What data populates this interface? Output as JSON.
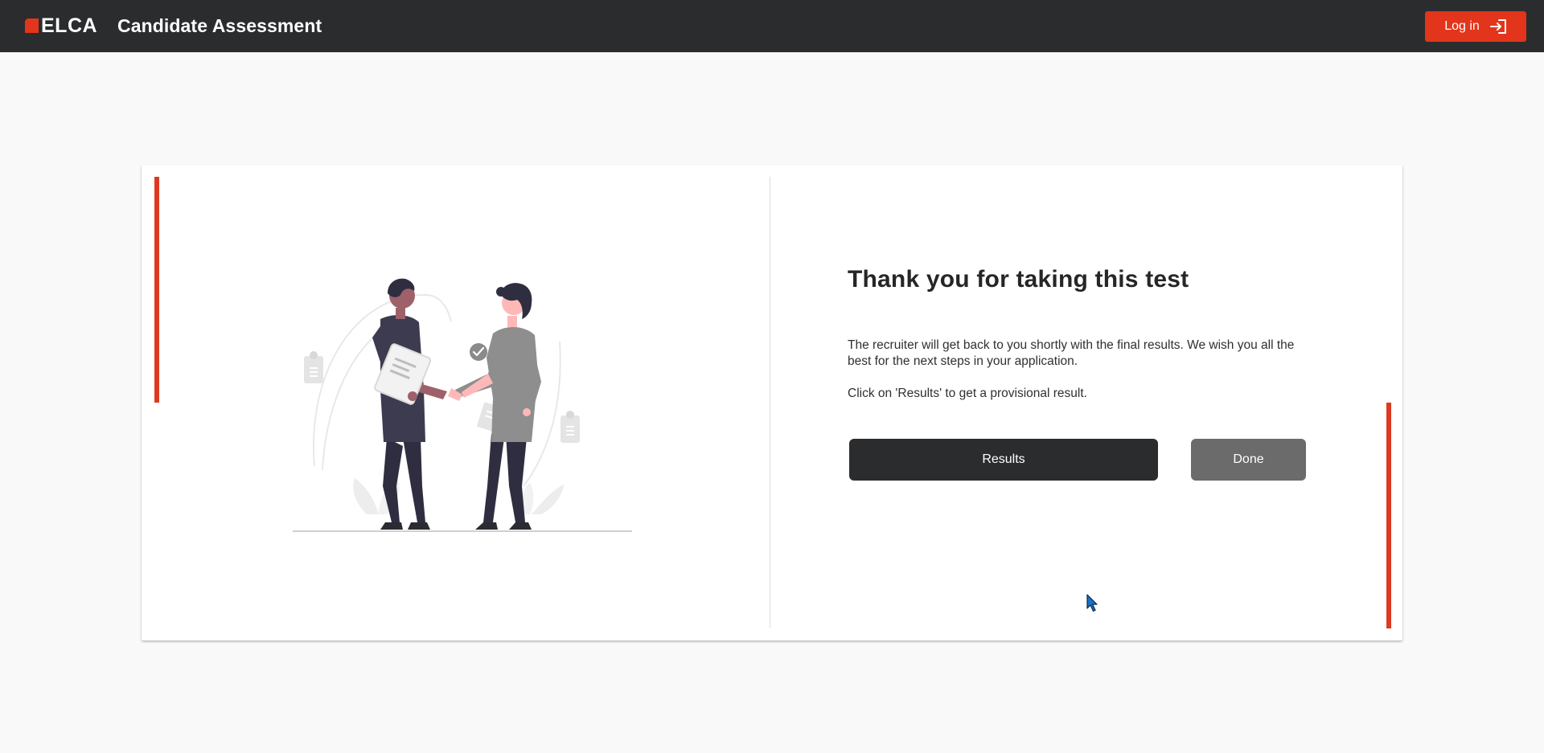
{
  "header": {
    "logo_text": "ELCA",
    "app_title": "Candidate Assessment",
    "login_label": "Log in",
    "login_icon": "login-icon"
  },
  "main": {
    "illustration": "handshake-illustration",
    "heading": "Thank you for taking this test",
    "message": "The recruiter will get back to you shortly with the final results. We wish you all the best for the next steps in your application.",
    "hint": "Click on 'Results' to get a provisional result.",
    "results_label": "Results",
    "done_label": "Done"
  },
  "colors": {
    "header_bg": "#2b2c2e",
    "accent": "#e2351b",
    "primary_button": "#2b2c2e",
    "secondary_button": "#6b6b6b"
  }
}
